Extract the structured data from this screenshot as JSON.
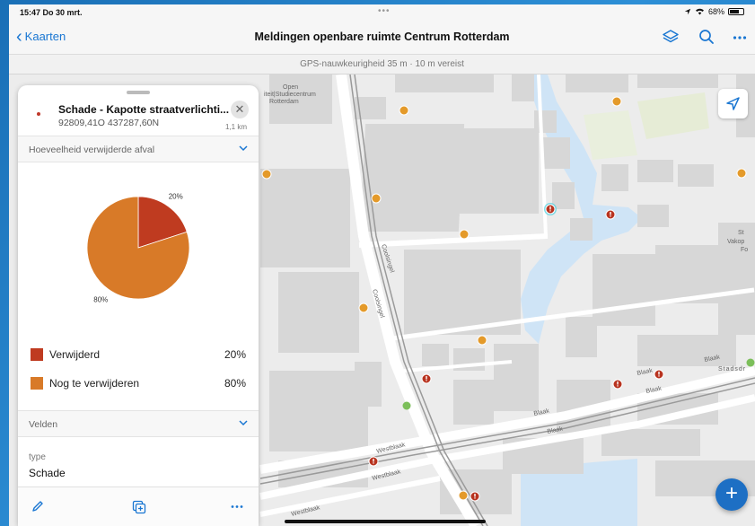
{
  "status_bar": {
    "time": "15:47",
    "date": "Do 30 mrt.",
    "battery": "68%",
    "battery_level": 0.68
  },
  "nav": {
    "back_label": "Kaarten",
    "title": "Meldingen openbare ruimte Centrum Rotterdam",
    "icons": [
      "layers-icon",
      "search-icon",
      "more-icon"
    ]
  },
  "gps_banner": "GPS-nauwkeurigheid 35 m · 10 m vereist",
  "feature": {
    "title": "Schade - Kapotte straatverlichti...",
    "coords": "92809,41O 437287,60N",
    "distance": "1,1 km"
  },
  "chart_section": {
    "label": "Hoeveelheid verwijderde afval"
  },
  "chart_data": {
    "type": "pie",
    "categories": [
      "Verwijderd",
      "Nog te verwijderen"
    ],
    "values": [
      20,
      80
    ],
    "labels": [
      "20%",
      "80%"
    ],
    "colors": [
      "#bf3b20",
      "#d87a28"
    ]
  },
  "legend": [
    {
      "label": "Verwijderd",
      "value": "20%"
    },
    {
      "label": "Nog te verwijderen",
      "value": "80%"
    }
  ],
  "fields_section": {
    "label": "Velden"
  },
  "fields": [
    {
      "label": "type",
      "value": "Schade"
    }
  ],
  "map_labels": {
    "poi_line1": "Open",
    "poi_line2": "iteit|Studiecentrum",
    "poi_line3": "Rotterdam",
    "coolsingel": "Coolsingel",
    "coolsingel2": "Coolsingel",
    "westblaak1": "Westblaak",
    "westblaak2": "Westblaak",
    "westblaak3": "Westblaak",
    "blaak1": "Blaak",
    "blaak2": "Blaak",
    "blaak3": "Blaak",
    "blaak4": "Blaak",
    "blaak5": "Blaak",
    "stadsdriehoek": "Stadsdr",
    "vakop1": "St",
    "vakop2": "Vakop",
    "vakop3": "Fo"
  }
}
